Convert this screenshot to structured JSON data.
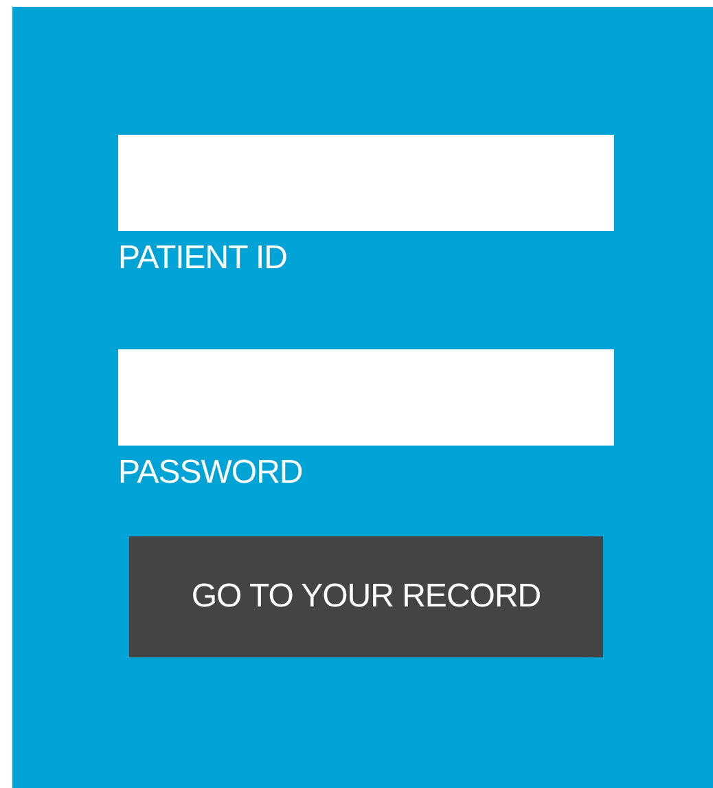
{
  "fields": [
    {
      "label": "PATIENT ID"
    },
    {
      "label": "PASSWORD"
    }
  ],
  "button": "GO TO YOUR RECORD"
}
